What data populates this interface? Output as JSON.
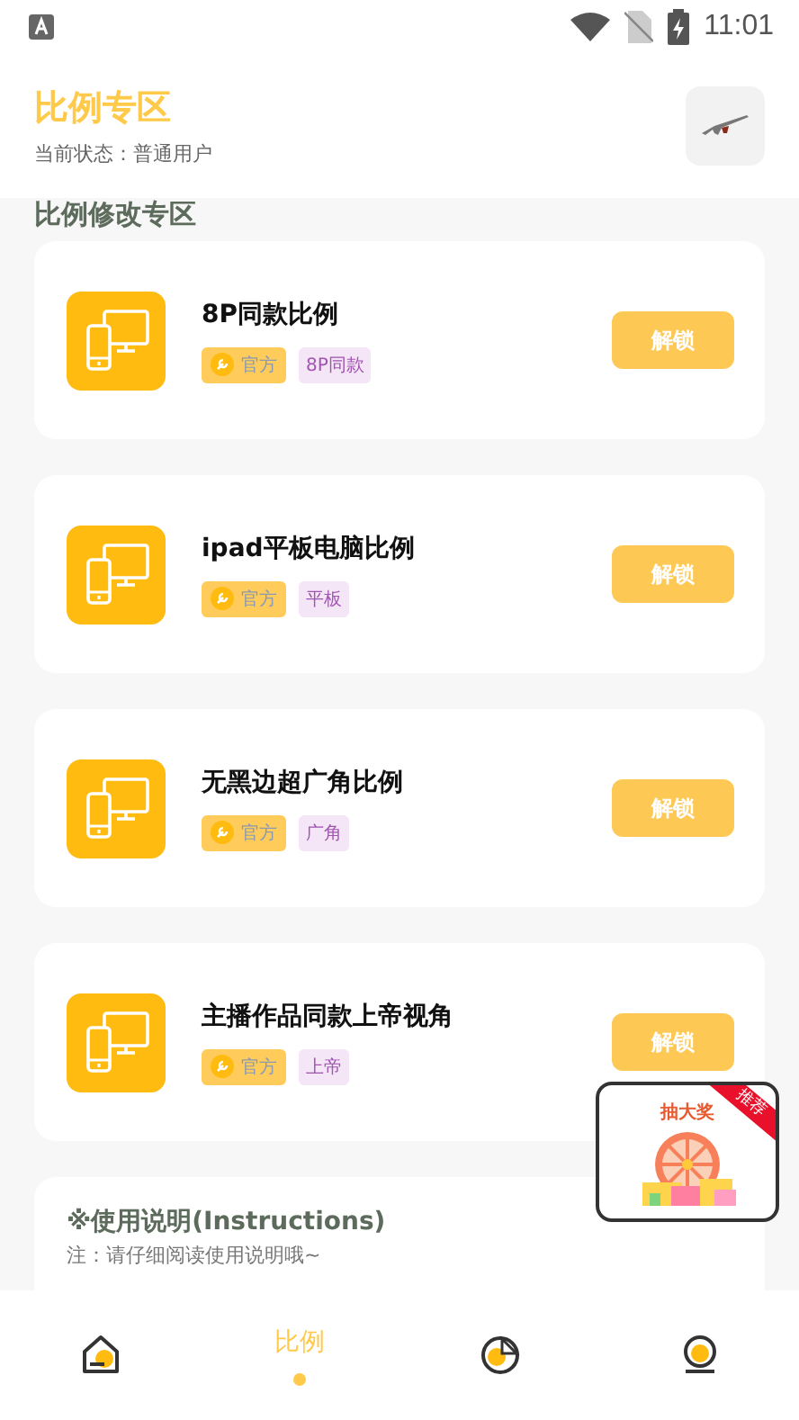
{
  "status_bar": {
    "time": "11:01"
  },
  "header": {
    "title": "比例专区",
    "subtitle": "当前状态：普通用户"
  },
  "section_title": "比例修改专区",
  "items": [
    {
      "title": "8P同款比例",
      "badge": "官方",
      "tag": "8P同款",
      "button": "解锁"
    },
    {
      "title": "ipad平板电脑比例",
      "badge": "官方",
      "tag": "平板",
      "button": "解锁"
    },
    {
      "title": "无黑边超广角比例",
      "badge": "官方",
      "tag": "广角",
      "button": "解锁"
    },
    {
      "title": "主播作品同款上帝视角",
      "badge": "官方",
      "tag": "上帝",
      "button": "解锁"
    }
  ],
  "instructions": {
    "title": "※使用说明(Instructions)",
    "note": "注：请仔细阅读使用说明哦~"
  },
  "promo": {
    "title": "抽大奖",
    "ribbon": "推荐"
  },
  "nav": [
    {
      "kind": "home",
      "selected": false
    },
    {
      "kind": "ratio",
      "label": "比例",
      "selected": true
    },
    {
      "kind": "chart",
      "selected": false
    },
    {
      "kind": "profile",
      "selected": false
    }
  ]
}
